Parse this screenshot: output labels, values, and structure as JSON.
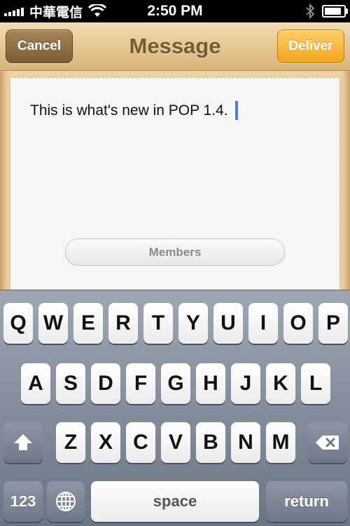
{
  "status_bar": {
    "carrier": "中華電信",
    "time": "2:50 PM",
    "icons": [
      "signal-bars-icon",
      "wifi-icon",
      "bluetooth-icon",
      "battery-icon"
    ],
    "battery_level": 0.9
  },
  "nav": {
    "title": "Message",
    "cancel_label": "Cancel",
    "deliver_label": "Deliver"
  },
  "composer": {
    "text": "This is what's new in POP 1.4.",
    "members_label": "Members"
  },
  "keyboard": {
    "row1": [
      "Q",
      "W",
      "E",
      "R",
      "T",
      "Y",
      "U",
      "I",
      "O",
      "P"
    ],
    "row2": [
      "A",
      "S",
      "D",
      "F",
      "G",
      "H",
      "J",
      "K",
      "L"
    ],
    "row3": [
      "Z",
      "X",
      "C",
      "V",
      "B",
      "N",
      "M"
    ],
    "numbers_label": "123",
    "space_label": "space",
    "return_label": "return",
    "shift_icon": "shift-arrow-icon",
    "delete_icon": "backspace-icon",
    "globe_icon": "globe-icon"
  },
  "colors": {
    "deliver": "#f2a51c",
    "cancel": "#7c5c36",
    "title": "#7a5a33",
    "caret": "#4a7bdc"
  }
}
